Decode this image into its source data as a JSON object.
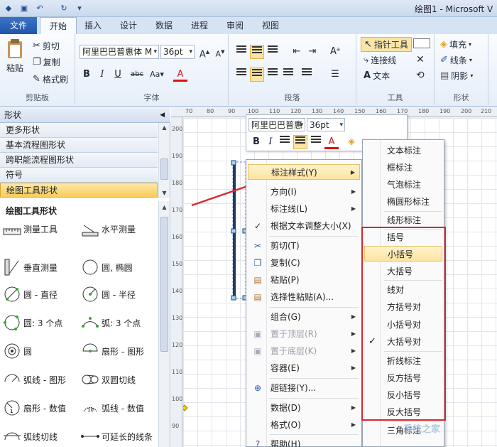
{
  "app": {
    "title": "绘图1 - Microsoft V"
  },
  "tabs": {
    "file": "文件",
    "items": [
      "开始",
      "插入",
      "设计",
      "数据",
      "进程",
      "审阅",
      "视图"
    ]
  },
  "ribbon": {
    "clipboard": {
      "paste": "粘贴",
      "cut": "剪切",
      "copy": "复制",
      "format_painter": "格式刷",
      "label": "剪贴板"
    },
    "font": {
      "family": "阿里巴巴普惠体 M",
      "size": "36pt",
      "label": "字体"
    },
    "paragraph": {
      "label": "段落"
    },
    "tools": {
      "pointer": "指针工具",
      "connector": "连接线",
      "text": "文本",
      "label": "工具"
    },
    "shape": {
      "fill": "填充",
      "line": "线条",
      "shadow": "阴影",
      "label": "形状"
    }
  },
  "panel": {
    "title": "形状",
    "stencils": [
      "更多形状",
      "基本流程图形状",
      "跨职能流程图形状",
      "符号",
      "绘图工具形状"
    ],
    "shapes_title": "绘图工具形状",
    "shapes": [
      "测量工具",
      "水平测量",
      "垂直测量",
      "圆, 椭圆",
      "圆 - 直径",
      "圆 - 半径",
      "圆: 3 个点",
      "弧: 3 个点",
      "圆",
      "扇形 - 图形",
      "弧线 - 图形",
      "双圆切线",
      "扇形 - 数值",
      "弧线 - 数值",
      "弧线切线",
      "可延长的线条"
    ]
  },
  "rulers": {
    "h": [
      "70",
      "80",
      "90",
      "100",
      "110",
      "120",
      "130",
      "140",
      "150",
      "160",
      "170",
      "180",
      "190",
      "200",
      "210"
    ],
    "v": [
      "200",
      "190",
      "180",
      "170",
      "160",
      "150",
      "140",
      "130",
      "120",
      "110",
      "100",
      "90"
    ]
  },
  "minibar": {
    "font": "阿里巴巴普惠",
    "size": "36pt"
  },
  "context_menu": {
    "items": [
      "标注样式(Y)",
      "方向(I)",
      "标注线(L)",
      "根据文本调整大小(X)",
      "剪切(T)",
      "复制(C)",
      "粘贴(P)",
      "选择性粘贴(A)...",
      "组合(G)",
      "置于顶层(R)",
      "置于底层(K)",
      "容器(E)",
      "超链接(Y)...",
      "数据(D)",
      "格式(O)",
      "帮助(H)"
    ]
  },
  "submenu": {
    "items": [
      "文本标注",
      "框标注",
      "气泡标注",
      "椭圆形标注",
      "线形标注",
      "括号",
      "小括号",
      "大括号",
      "线对",
      "方括号对",
      "小括号对",
      "大括号对",
      "折线标注",
      "反方括号",
      "反小括号",
      "反大括号",
      "三角标注"
    ]
  },
  "watermark": "系统之家",
  "colors": {
    "highlight": "#fde3a0",
    "redbox": "#d9272e",
    "file_tab": "#2a63b8"
  }
}
